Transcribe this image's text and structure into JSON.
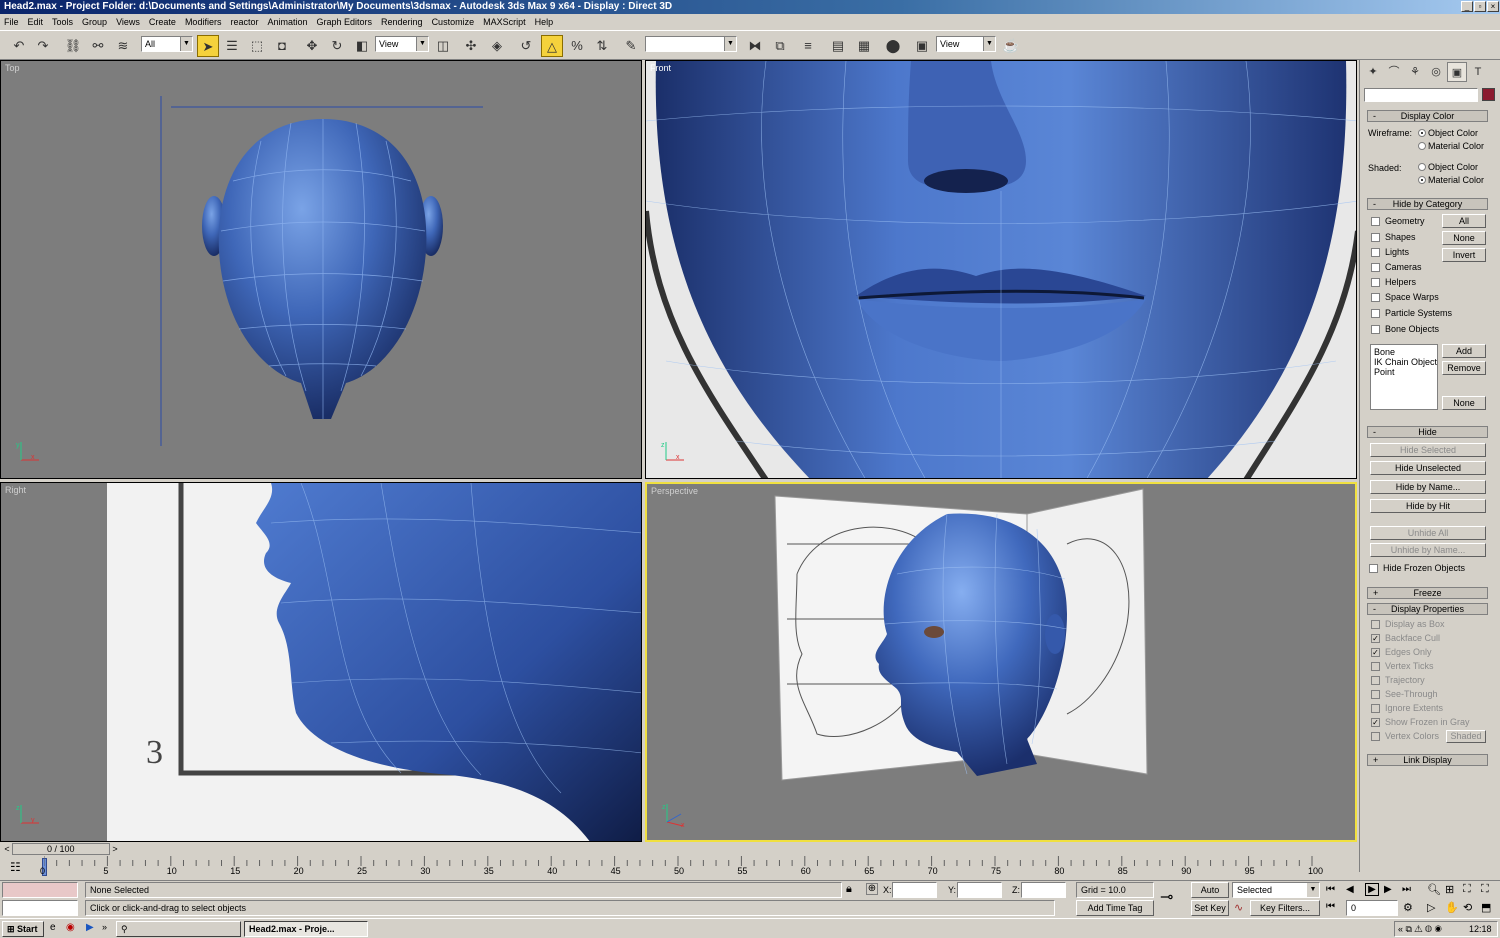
{
  "window": {
    "title": "Head2.max     - Project Folder: d:\\Documents and Settings\\Administrator\\My Documents\\3dsmax     - Autodesk 3ds Max 9 x64     - Display : Direct 3D"
  },
  "menu": [
    "File",
    "Edit",
    "Tools",
    "Group",
    "Views",
    "Create",
    "Modifiers",
    "reactor",
    "Animation",
    "Graph Editors",
    "Rendering",
    "Customize",
    "MAXScript",
    "Help"
  ],
  "toolbar": {
    "selection_filter": "All",
    "ref_coord_1": "View",
    "ref_coord_2": "View",
    "named_selection": ""
  },
  "viewports": {
    "top": "Top",
    "front": "Front",
    "right": "Right",
    "perspective": "Perspective"
  },
  "panel": {
    "name_field": "",
    "object_color": "#8b1a2e",
    "display_color": {
      "header": "Display Color",
      "wireframe_label": "Wireframe:",
      "shaded_label": "Shaded:",
      "object_color": "Object Color",
      "material_color": "Material Color"
    },
    "hide_by_category": {
      "header": "Hide by Category",
      "items": [
        "Geometry",
        "Shapes",
        "Lights",
        "Cameras",
        "Helpers",
        "Space Warps",
        "Particle Systems",
        "Bone Objects"
      ],
      "btn_all": "All",
      "btn_none": "None",
      "btn_invert": "Invert",
      "list": [
        "Bone",
        "IK Chain Object",
        "Point"
      ],
      "btn_add": "Add",
      "btn_remove": "Remove",
      "btn_none2": "None"
    },
    "hide": {
      "header": "Hide",
      "hide_selected": "Hide Selected",
      "hide_unselected": "Hide Unselected",
      "hide_by_name": "Hide by Name...",
      "hide_by_hit": "Hide by Hit",
      "unhide_all": "Unhide All",
      "unhide_by_name": "Unhide by Name...",
      "hide_frozen": "Hide Frozen Objects"
    },
    "freeze": {
      "header": "Freeze"
    },
    "display_properties": {
      "header": "Display Properties",
      "items": [
        "Display as Box",
        "Backface Cull",
        "Edges Only",
        "Vertex Ticks",
        "Trajectory",
        "See-Through",
        "Ignore Extents",
        "Show Frozen in Gray",
        "Vertex Colors"
      ],
      "shaded_btn": "Shaded"
    },
    "link_display": {
      "header": "Link Display"
    }
  },
  "timeline": {
    "slider": "0 / 100",
    "ticks": [
      "0",
      "5",
      "10",
      "15",
      "20",
      "25",
      "30",
      "35",
      "40",
      "45",
      "50",
      "55",
      "60",
      "65",
      "70",
      "75",
      "80",
      "85",
      "90",
      "95",
      "100"
    ]
  },
  "status": {
    "selection": "None Selected",
    "prompt": "Click or click-and-drag to select objects",
    "x_label": "X:",
    "y_label": "Y:",
    "z_label": "Z:",
    "grid": "Grid = 10.0",
    "add_time_tag": "Add Time Tag",
    "auto_key": "Auto Key",
    "set_key": "Set Key",
    "key_filter": "Selected",
    "key_filters": "Key Filters...",
    "frame": "0"
  },
  "taskbar": {
    "start": "Start",
    "task1": "Head2.max - Proje...",
    "clock": "12:18"
  }
}
